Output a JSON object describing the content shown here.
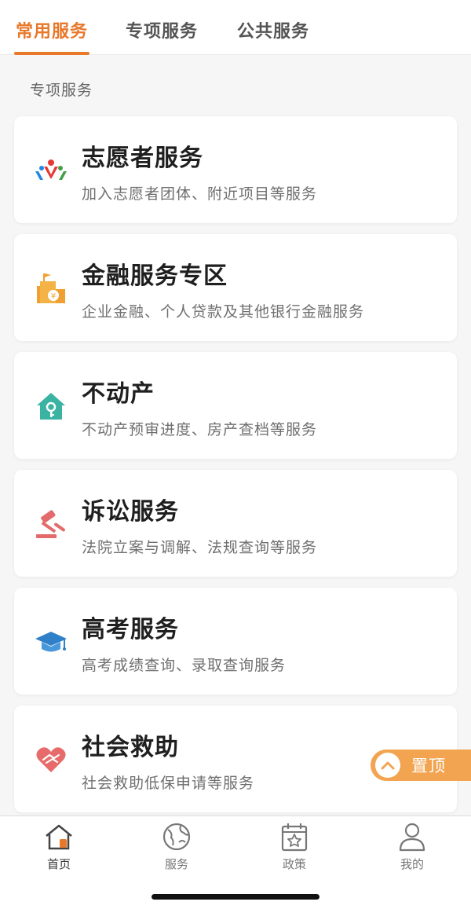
{
  "tabs": [
    {
      "label": "常用服务",
      "active": true
    },
    {
      "label": "专项服务",
      "active": false
    },
    {
      "label": "公共服务",
      "active": false
    }
  ],
  "section": {
    "label": "专项服务"
  },
  "cards": [
    {
      "title": "志愿者服务",
      "desc": "加入志愿者团体、附近项目等服务",
      "icon": "volunteer-icon"
    },
    {
      "title": "金融服务专区",
      "desc": "企业金融、个人贷款及其他银行金融服务",
      "icon": "bank-icon"
    },
    {
      "title": "不动产",
      "desc": "不动产预审进度、房产查档等服务",
      "icon": "house-key-icon"
    },
    {
      "title": "诉讼服务",
      "desc": "法院立案与调解、法规查询等服务",
      "icon": "gavel-icon"
    },
    {
      "title": "高考服务",
      "desc": "高考成绩查询、录取查询服务",
      "icon": "graduation-cap-icon"
    },
    {
      "title": "社会救助",
      "desc": "社会救助低保申请等服务",
      "icon": "heart-hands-icon"
    }
  ],
  "pin_top": {
    "label": "置顶"
  },
  "bottom_nav": [
    {
      "label": "首页",
      "icon": "home-icon",
      "active": true
    },
    {
      "label": "服务",
      "icon": "globe-icon",
      "active": false
    },
    {
      "label": "政策",
      "icon": "calendar-star-icon",
      "active": false
    },
    {
      "label": "我的",
      "icon": "person-icon",
      "active": false
    }
  ],
  "colors": {
    "accent": "#e8782a",
    "pin": "#f2a451"
  }
}
